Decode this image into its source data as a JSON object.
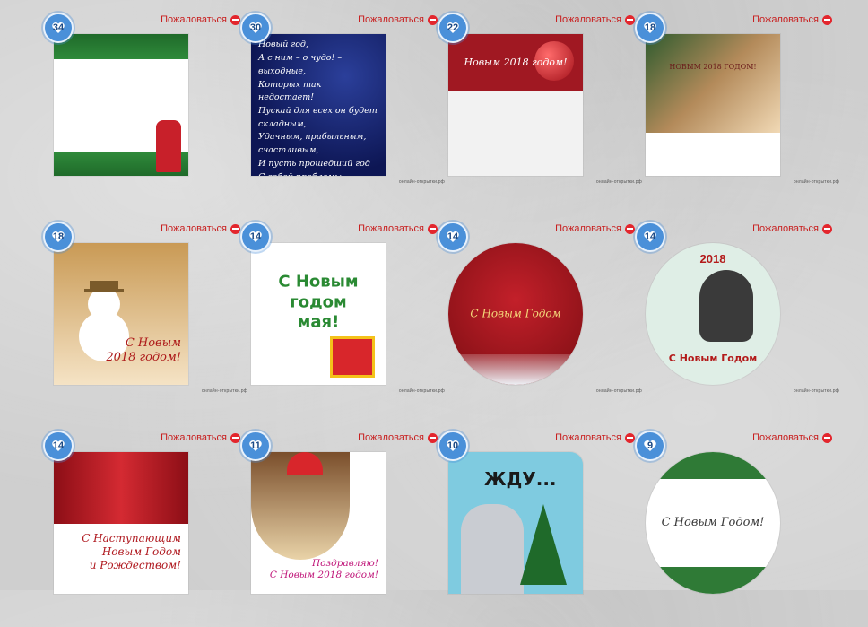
{
  "report_label": "Пожаловаться",
  "watermark": "онлайн-открытки.рф",
  "cards": [
    {
      "likes": "34",
      "caption": ""
    },
    {
      "likes": "30",
      "caption": "Коллеги наши дорогие!\nГрядет волшебный Новый год,\nА с ним – о чудо! – выходные,\nКоторых так недостает!\nПускай для всех он будет складным,\nУдачным, прибыльным, счастливым,\nИ пусть прошедший год\nС собой проблемы заберет!"
    },
    {
      "likes": "22",
      "caption": "Новым 2018 годом!"
    },
    {
      "likes": "18",
      "caption": "НОВЫМ 2018 ГОДОМ!"
    },
    {
      "likes": "18",
      "caption": "С Новым\n2018 годом!"
    },
    {
      "likes": "14",
      "caption": "С Новым\nгодом\nмая!"
    },
    {
      "likes": "14",
      "caption": "С Новым Годом"
    },
    {
      "likes": "14",
      "caption": "С Новым Годом",
      "year": "2018"
    },
    {
      "likes": "14",
      "caption": "С Наступающим\nНовым Годом\nи Рождеством!"
    },
    {
      "likes": "11",
      "caption": "Поздравляю!\nС Новым 2018 годом!"
    },
    {
      "likes": "10",
      "caption": "ЖДУ..."
    },
    {
      "likes": "9",
      "caption": "С Новым Годом!"
    }
  ]
}
